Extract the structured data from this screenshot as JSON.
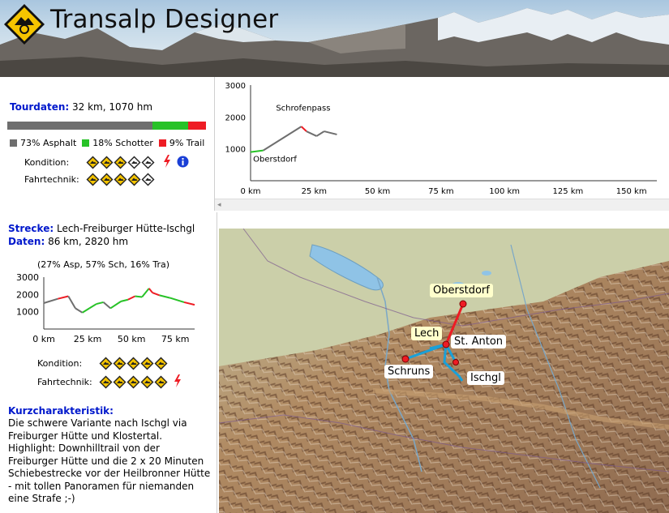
{
  "app": {
    "title": "Transalp Designer"
  },
  "tour": {
    "label": "Tourdaten:",
    "value": " 32 km, 1070 hm",
    "surface": [
      {
        "name": "Asphalt",
        "percent": 73,
        "color": "#6e6e6e",
        "text": "73% Asphalt"
      },
      {
        "name": "Schotter",
        "percent": 18,
        "color": "#27c227",
        "text": "18% Schotter"
      },
      {
        "name": "Trail",
        "percent": 9,
        "color": "#ee1c24",
        "text": "9% Trail"
      }
    ],
    "kondition_label": "Kondition:",
    "kondition_level": 3,
    "fahrtechnik_label": "Fahrtechnik:",
    "fahrtechnik_level": 4
  },
  "top_profile": {
    "chart_data": {
      "type": "line",
      "ylim": [
        0,
        3000
      ],
      "yticks": [
        "3000",
        "2000",
        "1000"
      ],
      "xticks": [
        "0 km",
        "25 km",
        "50 km",
        "75 km",
        "100 km",
        "125 km",
        "150 km"
      ],
      "annotations": [
        {
          "text": "Schrofenpass"
        },
        {
          "text": "Oberstdorf"
        }
      ],
      "series": [
        {
          "x": [
            0,
            5,
            20,
            22,
            26,
            29,
            34
          ],
          "y": [
            900,
            950,
            1700,
            1550,
            1400,
            1550,
            1450
          ]
        }
      ]
    }
  },
  "route": {
    "strecke_label": "Strecke:",
    "strecke_value": " Lech-Freiburger Hütte-Ischgl",
    "daten_label": "Daten:",
    "daten_value": " 86 km, 2820 hm",
    "percent_text": "(27% Asp, 57% Sch, 16% Tra)",
    "kondition_label": "Kondition:",
    "kondition_level": 5,
    "fahrtechnik_label": "Fahrtechnik:",
    "fahrtechnik_level": 5,
    "profile": {
      "chart_data": {
        "type": "line",
        "ylim": [
          0,
          3000
        ],
        "yticks": [
          "3000",
          "2000",
          "1000"
        ],
        "xticks": [
          "0 km",
          "25 km",
          "50 km",
          "75 km"
        ],
        "series": [
          {
            "x": [
              0,
              8,
              14,
              18,
              22,
              26,
              30,
              34,
              38,
              44,
              48,
              52,
              56,
              60,
              62,
              66,
              72,
              80,
              86
            ],
            "y": [
              1500,
              1750,
              1900,
              1200,
              950,
              1200,
              1450,
              1550,
              1200,
              1600,
              1700,
              1900,
              1850,
              2350,
              2100,
              1950,
              1800,
              1550,
              1400
            ]
          }
        ]
      }
    },
    "kurz_title": "Kurzcharakteristik:",
    "kurz_text": "Die schwere Variante nach Ischgl via Freiburger Hütte und Klostertal. Highlight: Downhilltrail von der Freiburger Hütte und die 2 x 20 Minuten Schiebestrecke vor der Heilbronner Hütte - mit tollen Panoramen für niemanden eine Strafe ;-)"
  },
  "map": {
    "labels": {
      "oberstdorf": "Oberstdorf",
      "lech": "Lech",
      "st_anton": "St. Anton",
      "schruns": "Schruns",
      "ischgl": "Ischgl"
    }
  },
  "colors": {
    "accent_blue": "#0018cc",
    "route_red": "#ee1c24",
    "route_cyan": "#1aa0d8",
    "diamond_yellow": "#f5c400"
  },
  "icons": {
    "logo": "mountain-bike-logo-icon",
    "lightning": "lightning-icon",
    "info": "info-icon"
  }
}
